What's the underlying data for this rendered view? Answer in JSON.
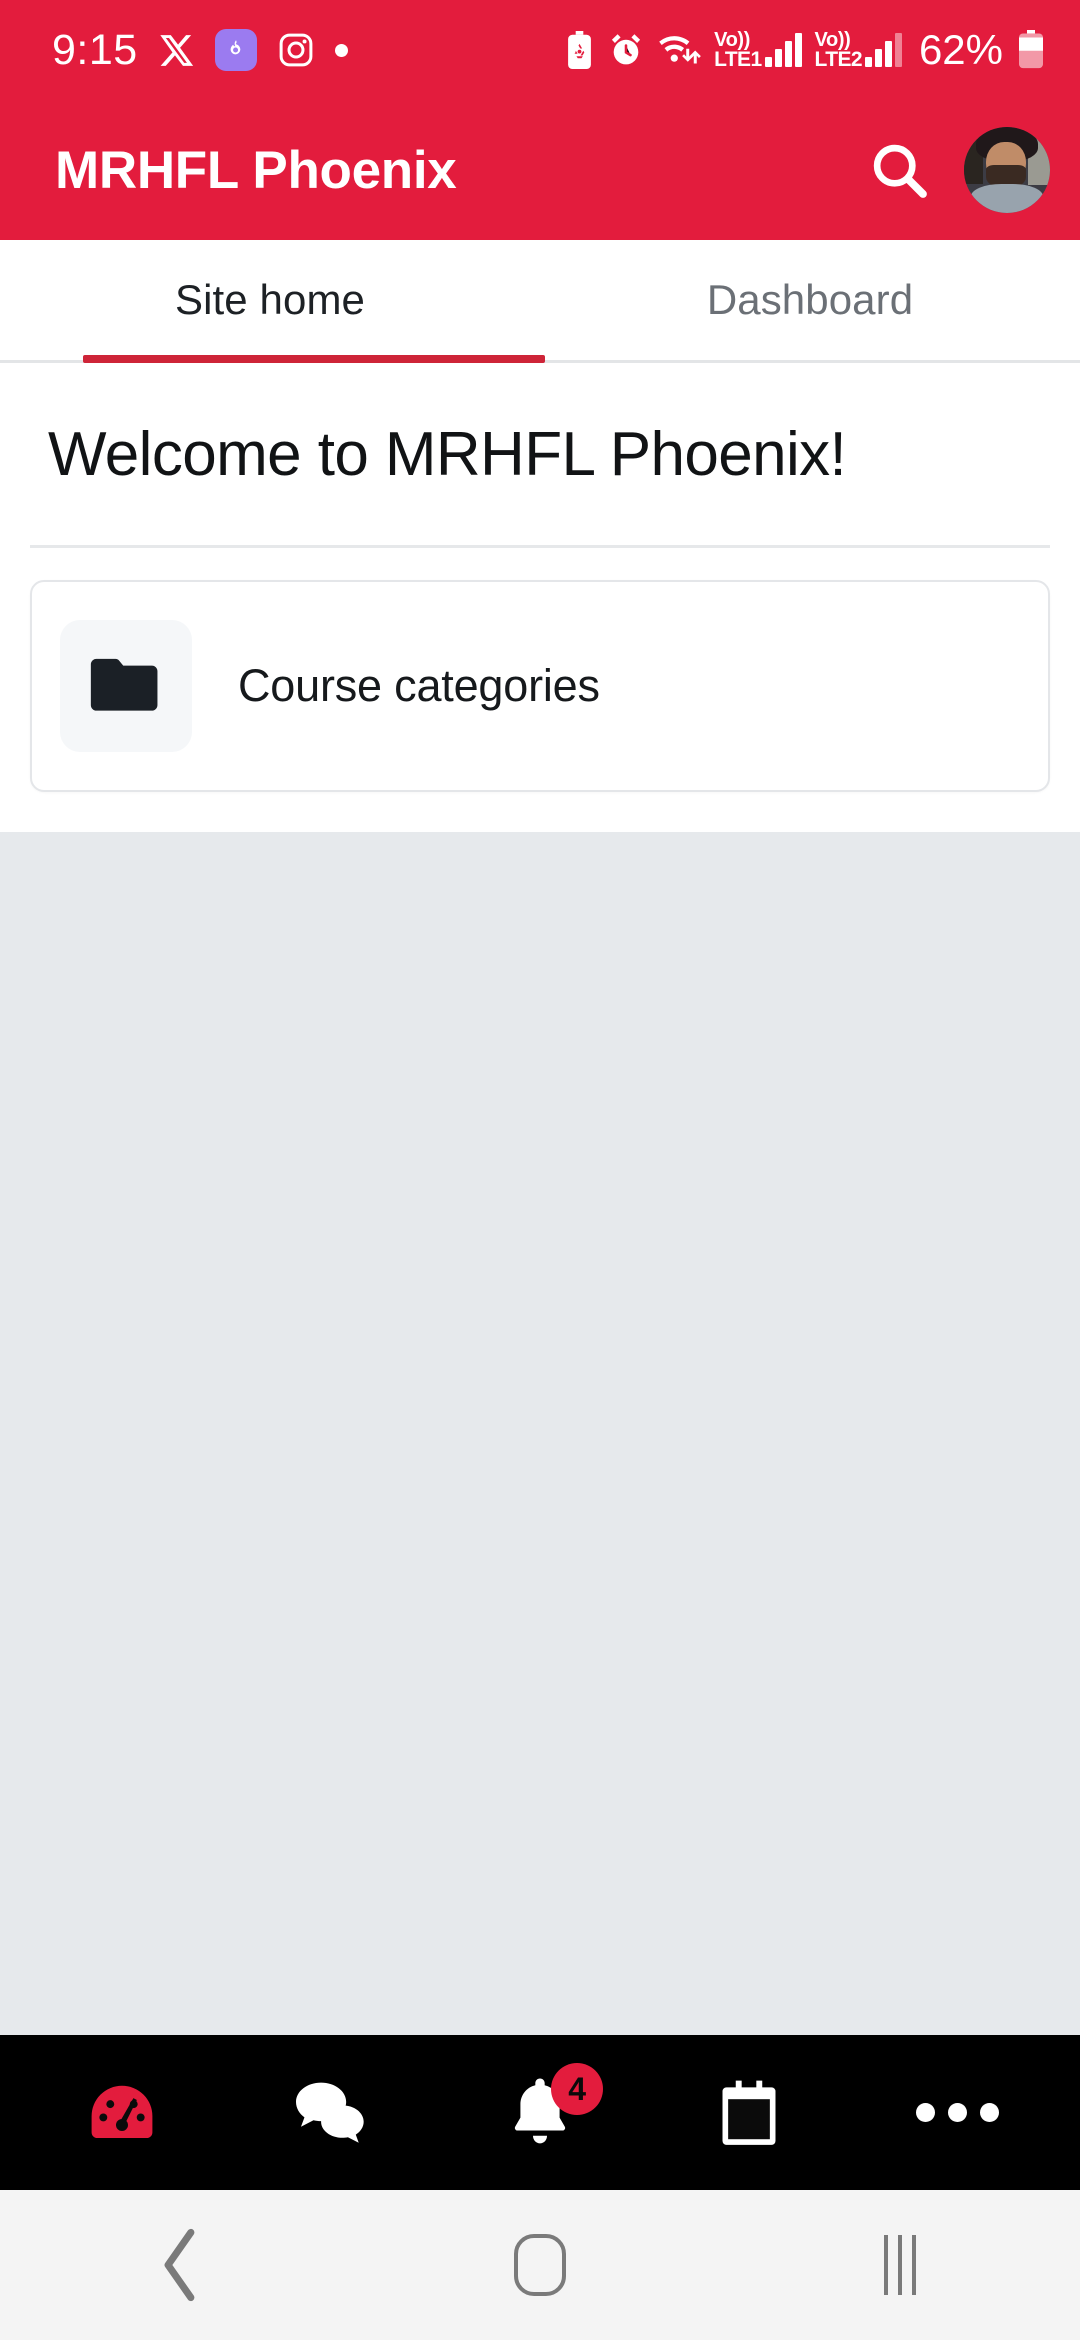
{
  "statusbar": {
    "time": "9:15",
    "battery_percent": "62%",
    "left_icons": [
      "x-twitter-icon",
      "purple-app-icon",
      "instagram-icon",
      "dot-indicator-icon"
    ],
    "right_icons": [
      "battery-saver-icon",
      "alarm-icon",
      "wifi-icon"
    ],
    "sim1": {
      "volte_label": "Vo))",
      "network_label": "LTE1"
    },
    "sim2": {
      "volte_label": "Vo))",
      "network_label": "LTE2"
    }
  },
  "appbar": {
    "title": "MRHFL Phoenix",
    "search_icon": "search-icon",
    "avatar_icon": "user-avatar"
  },
  "tabs": [
    {
      "label": "Site home",
      "active": true
    },
    {
      "label": "Dashboard",
      "active": false
    }
  ],
  "main": {
    "welcome_heading": "Welcome to MRHFL Phoenix!",
    "cards": [
      {
        "label": "Course categories",
        "icon": "folder-icon"
      }
    ]
  },
  "bottomnav": [
    {
      "name": "dashboard",
      "icon": "speedometer-icon",
      "active": true,
      "badge": null
    },
    {
      "name": "messages",
      "icon": "chat-bubbles-icon",
      "active": false,
      "badge": null
    },
    {
      "name": "notifications",
      "icon": "bell-icon",
      "active": false,
      "badge": "4"
    },
    {
      "name": "calendar",
      "icon": "calendar-icon",
      "active": false,
      "badge": null
    },
    {
      "name": "more",
      "icon": "more-horizontal-icon",
      "active": false,
      "badge": null
    }
  ],
  "androidnav": [
    {
      "name": "back",
      "icon": "chevron-left-icon"
    },
    {
      "name": "home",
      "icon": "home-circle-icon"
    },
    {
      "name": "recents",
      "icon": "recents-bars-icon"
    }
  ],
  "colors": {
    "brand_red": "#E31C3D",
    "tab_indicator": "#CE2438",
    "page_background": "#E6E9EC",
    "bottom_nav_background": "#000000",
    "android_nav_background": "#F4F4F4"
  }
}
